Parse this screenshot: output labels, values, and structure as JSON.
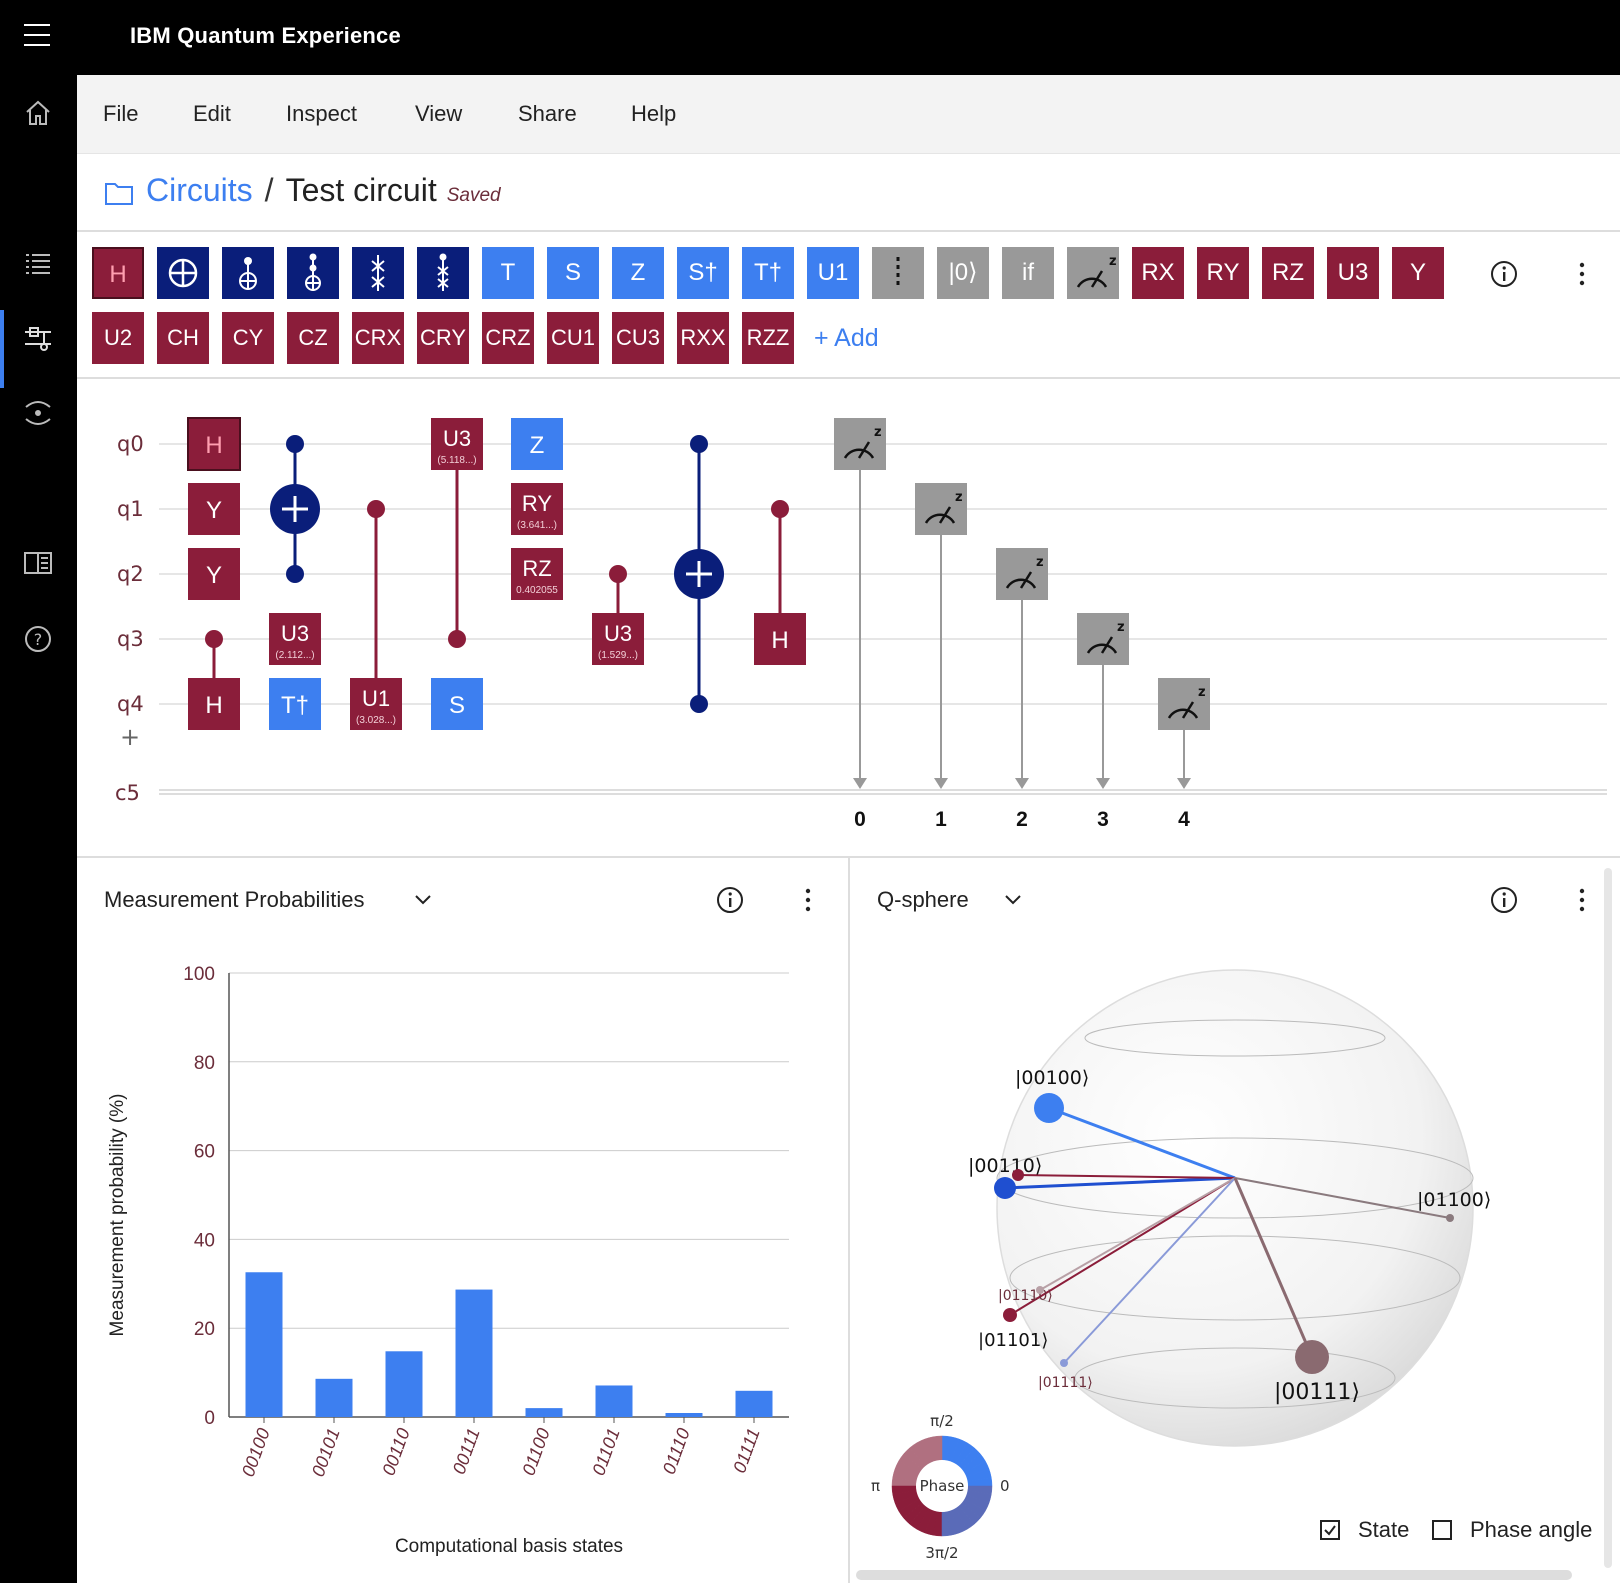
{
  "app": {
    "title": "IBM Quantum Experience"
  },
  "menu": [
    "File",
    "Edit",
    "Inspect",
    "View",
    "Share",
    "Help"
  ],
  "breadcrumb": {
    "root": "Circuits",
    "separator": "/",
    "name": "Test circuit",
    "status": "Saved"
  },
  "palette": {
    "row1": [
      {
        "label": "H",
        "style": "sel"
      },
      {
        "label": "",
        "icon": "cnot-icon",
        "style": "navy"
      },
      {
        "label": "",
        "icon": "controlled-not-icon",
        "style": "navy"
      },
      {
        "label": "",
        "icon": "toffoli-icon",
        "style": "navy"
      },
      {
        "label": "",
        "icon": "swap-icon",
        "style": "navy"
      },
      {
        "label": "",
        "icon": "fredkin-icon",
        "style": "navy"
      },
      {
        "label": "T",
        "style": "blue"
      },
      {
        "label": "S",
        "style": "blue"
      },
      {
        "label": "Z",
        "style": "blue"
      },
      {
        "label": "S†",
        "style": "blue"
      },
      {
        "label": "T†",
        "style": "blue"
      },
      {
        "label": "U1",
        "style": "blue"
      },
      {
        "label": "",
        "icon": "barrier-icon",
        "style": "gray"
      },
      {
        "label": "|0⟩",
        "style": "gray"
      },
      {
        "label": "if",
        "style": "gray"
      },
      {
        "label": "",
        "icon": "measure-icon",
        "style": "gray"
      },
      {
        "label": "RX",
        "style": "maroon"
      },
      {
        "label": "RY",
        "style": "maroon"
      },
      {
        "label": "RZ",
        "style": "maroon"
      },
      {
        "label": "U3",
        "style": "maroon"
      },
      {
        "label": "Y",
        "style": "maroon"
      }
    ],
    "row2": [
      "U2",
      "CH",
      "CY",
      "CZ",
      "CRX",
      "CRY",
      "CRZ",
      "CU1",
      "CU3",
      "RXX",
      "RZZ"
    ],
    "add_label": "+ Add"
  },
  "circuit": {
    "qubits": [
      "q0",
      "q1",
      "q2",
      "q3",
      "q4"
    ],
    "add_symbol": "+",
    "classical": "c5",
    "classical_bits": [
      "0",
      "1",
      "2",
      "3",
      "4"
    ],
    "gate_labels": {
      "h_q0": "H",
      "y_q1": "Y",
      "y_q2": "Y",
      "h_q4": "H",
      "u3_q3": "U3",
      "u3_q3_param": "(2.112...)",
      "tdg_q4": "T†",
      "u1_q4": "U1",
      "u1_q4_param": "(3.028...)",
      "u3_q0": "U3",
      "u3_q0_param": "(5.118...)",
      "s_q4": "S",
      "z_q0": "Z",
      "ry_q1": "RY",
      "ry_q1_param": "(3.641...)",
      "rz_q2": "RZ",
      "rz_q2_param": "0.402055",
      "u3_q3b": "U3",
      "u3_q3b_param": "(1.529...)",
      "h_q3": "H"
    }
  },
  "probabilities": {
    "title": "Measurement Probabilities",
    "chart_data": {
      "type": "bar",
      "categories": [
        "00100",
        "00101",
        "00110",
        "00111",
        "01100",
        "01101",
        "01110",
        "01111"
      ],
      "values": [
        32.6,
        8.6,
        14.8,
        28.7,
        2.0,
        7.1,
        0.9,
        5.9
      ],
      "xlabel": "Computational basis states",
      "ylabel": "Measurement probability (%)",
      "ylim": [
        0,
        100
      ],
      "yticks": [
        0,
        20,
        40,
        60,
        80,
        100
      ],
      "color": "#3d7ff0"
    }
  },
  "qsphere": {
    "title": "Q-sphere",
    "states": [
      "|00100⟩",
      "|00110⟩",
      "|01100⟩",
      "|01110⟩",
      "|01101⟩",
      "|01111⟩",
      "|00111⟩"
    ],
    "phase_wheel": {
      "center": "Phase",
      "top": "π/2",
      "left": "π",
      "right": "0",
      "bottom": "3π/2"
    },
    "options": [
      {
        "label": "State",
        "checked": true
      },
      {
        "label": "Phase angle",
        "checked": false
      }
    ]
  },
  "colors": {
    "maroon": "#8b1d3a",
    "navy": "#0a1e7a",
    "blue": "#3d7ff0",
    "gray": "#999999"
  }
}
